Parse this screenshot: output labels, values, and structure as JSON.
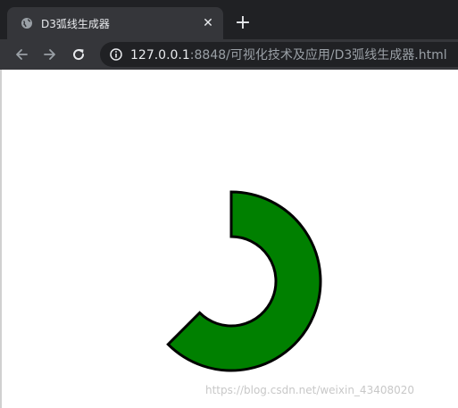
{
  "browser": {
    "tab": {
      "title": "D3弧线生成器",
      "close_glyph": "✕"
    },
    "new_tab_glyph": "+",
    "address": {
      "host": "127.0.0.1",
      "path": ":8848/可视化技术及应用/D3弧线生成器.html"
    }
  },
  "page": {
    "arc": {
      "inner_radius": 50,
      "outer_radius": 100,
      "start_angle_deg": 0,
      "end_angle_deg": 225,
      "fill": "#008000",
      "stroke": "#000000"
    },
    "watermark": "https://blog.csdn.net/weixin_43408020"
  },
  "colors": {
    "tabbar_bg": "#202124",
    "toolbar_bg": "#35363a",
    "omnibox_bg": "#202124"
  }
}
